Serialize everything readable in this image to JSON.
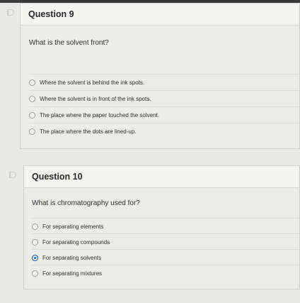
{
  "questions": [
    {
      "title": "Question 9",
      "prompt": "What is the solvent front?",
      "options": [
        {
          "label": "Where the solvent is behind the ink spots.",
          "selected": false
        },
        {
          "label": "Where the solvent is in front of the ink spots.",
          "selected": false
        },
        {
          "label": "The place where the paper touched the solvent.",
          "selected": false
        },
        {
          "label": "The place where the dots are lined-up.",
          "selected": false
        }
      ]
    },
    {
      "title": "Question 10",
      "prompt": "What is chromatography used for?",
      "options": [
        {
          "label": "For separating elements",
          "selected": false
        },
        {
          "label": "For separating compounds",
          "selected": false
        },
        {
          "label": "For separating solvents",
          "selected": true
        },
        {
          "label": "For separating mixtures",
          "selected": false
        }
      ]
    }
  ],
  "colors": {
    "selected_radio": "#1f5fb8",
    "page_background": "#e9e9e7"
  },
  "icons": {
    "question_flag": "flag-icon"
  }
}
